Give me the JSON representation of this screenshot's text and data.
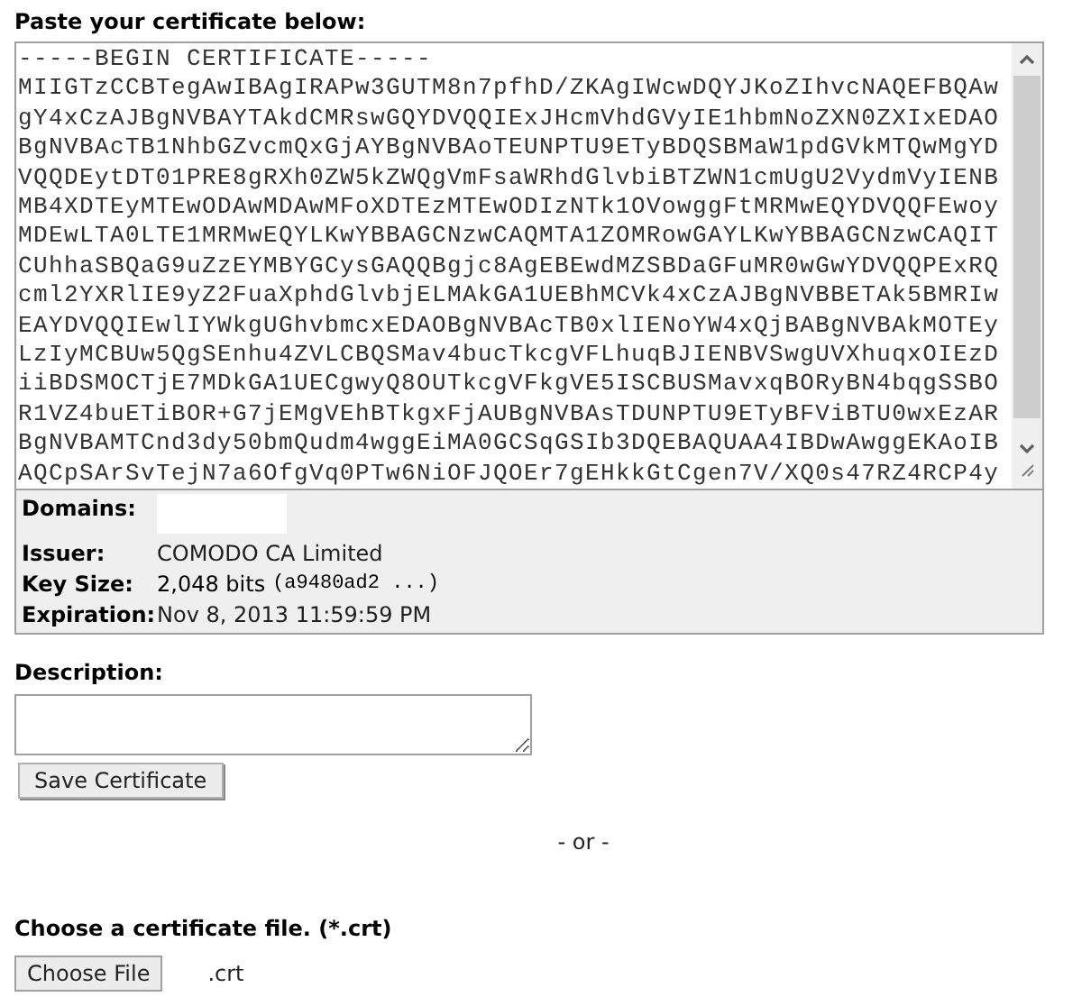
{
  "paste_heading": "Paste your certificate below:",
  "certificate_lines": [
    "-----BEGIN CERTIFICATE-----",
    "MIIGTzCCBTegAwIBAgIRAPw3GUTM8n7pfhD/ZKAgIWcwDQYJKoZIhvcNAQEFBQAw",
    "gY4xCzAJBgNVBAYTAkdCMRswGQYDVQQIExJHcmVhdGVyIE1hbmNoZXN0ZXIxEDAO",
    "BgNVBAcTB1NhbGZvcmQxGjAYBgNVBAoTEUNPTU9ETyBDQSBMaW1pdGVkMTQwMgYD",
    "VQQDEytDT01PRE8gRXh0ZW5kZWQgVmFsaWRhdGlvbiBTZWN1cmUgU2VydmVyIENB",
    "MB4XDTEyMTEwODAwMDAwMFoXDTEzMTEwODIzNTk1OVowggFtMRMwEQYDVQQFEwoy",
    "MDEwLTA0LTE1MRMwEQYLKwYBBAGCNzwCAQMTA1ZOMRowGAYLKwYBBAGCNzwCAQIT",
    "CUhhaSBQaG9uZzEYMBYGCysGAQQBgjc8AgEBEwdMZSBDaGFuMR0wGwYDVQQPExRQ",
    "cml2YXRlIE9yZ2FuaXphdGlvbjELMAkGA1UEBhMCVk4xCzAJBgNVBBETAk5BMRIw",
    "EAYDVQQIEwlIYWkgUGhvbmcxEDAOBgNVBAcTB0xlIENoYW4xQjBABgNVBAkMOTEy",
    "LzIyMCBUw5QgSEnhu4ZVLCBQSMav4bucTkcgVFLhuqBJIENBVSwgUVXhuqxOIEzD",
    "iiBDSMOCTjE7MDkGA1UECgwyQ8OUTkcgVFkgVE5ISCBUSMavxqBORyBN4bqgSSBO",
    "R1VZ4buETiBOR+G7jEMgVEhBTkgxFjAUBgNVBAsTDUNPTU9ETyBFViBTU0wxEzAR",
    "BgNVBAMTCnd3dy50bmQudm4wggEiMA0GCSqGSIb3DQEBAQUAA4IBDwAwggEKAoIB",
    "AQCpSArSvTejN7a6OfgVq0PTw6NiOFJQOEr7gEHkkGtCgen7V/XQ0s47RZ4RCP4y"
  ],
  "details": [
    {
      "kind": "blank",
      "label": "Domains:"
    },
    {
      "kind": "text",
      "label": "Issuer:",
      "value": "COMODO CA Limited"
    },
    {
      "kind": "keysize",
      "label": "Key Size:",
      "value": "2,048 bits",
      "hash": "(a9480ad2 ...)"
    },
    {
      "kind": "text",
      "label": "Expiration:",
      "value": "Nov 8, 2013 11:59:59 PM"
    }
  ],
  "description": {
    "label": "Description:"
  },
  "save_button": "Save Certificate",
  "separator": "- or -",
  "file": {
    "label": "Choose a certificate file. (*.crt)",
    "button": "Choose File",
    "value": ".crt"
  }
}
